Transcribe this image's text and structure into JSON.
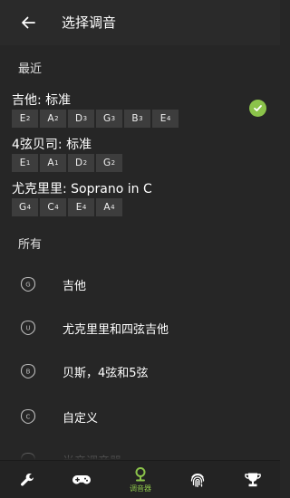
{
  "header": {
    "title": "选择调音"
  },
  "recent": {
    "label": "最近",
    "presets": [
      {
        "name": "吉他: 标准",
        "notes": [
          {
            "n": "E",
            "o": "2"
          },
          {
            "n": "A",
            "o": "2"
          },
          {
            "n": "D",
            "o": "3"
          },
          {
            "n": "G",
            "o": "3"
          },
          {
            "n": "B",
            "o": "3"
          },
          {
            "n": "E",
            "o": "4"
          }
        ],
        "selected": true
      },
      {
        "name": "4弦贝司: 标准",
        "notes": [
          {
            "n": "E",
            "o": "1"
          },
          {
            "n": "A",
            "o": "1"
          },
          {
            "n": "D",
            "o": "2"
          },
          {
            "n": "G",
            "o": "2"
          }
        ],
        "selected": false
      },
      {
        "name": "尤克里里: Soprano in C",
        "notes": [
          {
            "n": "G",
            "o": "4"
          },
          {
            "n": "C",
            "o": "4"
          },
          {
            "n": "E",
            "o": "4"
          },
          {
            "n": "A",
            "o": "4"
          }
        ],
        "selected": false
      }
    ]
  },
  "all": {
    "label": "所有",
    "items": [
      {
        "badge": "G",
        "label": "吉他"
      },
      {
        "badge": "U",
        "label": "尤克里里和四弦吉他"
      },
      {
        "badge": "B",
        "label": "贝斯，4弦和5弦"
      },
      {
        "badge": "C",
        "label": "自定义"
      },
      {
        "badge": "",
        "label": "半音调音器"
      }
    ]
  },
  "tabbar": {
    "tabs": [
      {
        "icon": "wrench-icon",
        "label": ""
      },
      {
        "icon": "gamepad-icon",
        "label": ""
      },
      {
        "icon": "tuner-icon",
        "label": "调音器",
        "active": true
      },
      {
        "icon": "fingerprint-icon",
        "label": ""
      },
      {
        "icon": "trophy-icon",
        "label": ""
      }
    ]
  },
  "colors": {
    "accent": "#8bc34a",
    "background": "#262626",
    "note_chip": "#3d3d3d"
  }
}
